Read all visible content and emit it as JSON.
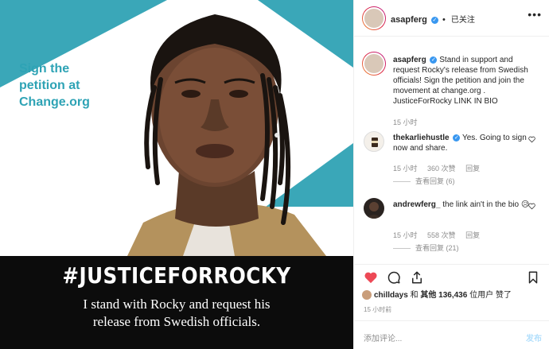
{
  "post_image": {
    "petition_line1": "Sign the",
    "petition_line2": "petition at",
    "petition_line3": "Change.org",
    "hashtag": "#JUSTICEFORROCKY",
    "statement_line1": "I stand with Rocky and request his",
    "statement_line2": "release from Swedish officials."
  },
  "header": {
    "username": "asapferg",
    "follow_label": "已关注",
    "more_icon": "ellipsis-icon"
  },
  "caption": {
    "username": "asapferg",
    "text": "Stand in support and request Rocky's release from Swedish officials! Sign the petition and join the movement at change.org . JusticeForRocky LINK IN BIO",
    "time": "15 小时"
  },
  "comments": [
    {
      "username": "thekarliehustle",
      "verified": true,
      "text": "Yes. Going to sign now and share.",
      "time": "15 小时",
      "likes": "360 次赞",
      "reply": "回复",
      "view_replies": "查看回复 (6)"
    },
    {
      "username": "andrewferg_",
      "verified": false,
      "text": "the link ain't in the bio",
      "emoji": "😥",
      "time": "15 小时",
      "likes": "558 次赞",
      "reply": "回复",
      "view_replies": "查看回复 (21)"
    }
  ],
  "likes": {
    "user": "chilldays",
    "connector": "和",
    "others": "其他",
    "count": "136,436",
    "suffix": "位用户 赞了"
  },
  "time_ago": "15 小时前",
  "add_comment": {
    "placeholder": "添加评论...",
    "post_label": "发布"
  },
  "colors": {
    "teal": "#3aa7b8",
    "verified_blue": "#3897f0",
    "heart_red": "#ed4956",
    "post_disabled": "#b2dffc"
  }
}
